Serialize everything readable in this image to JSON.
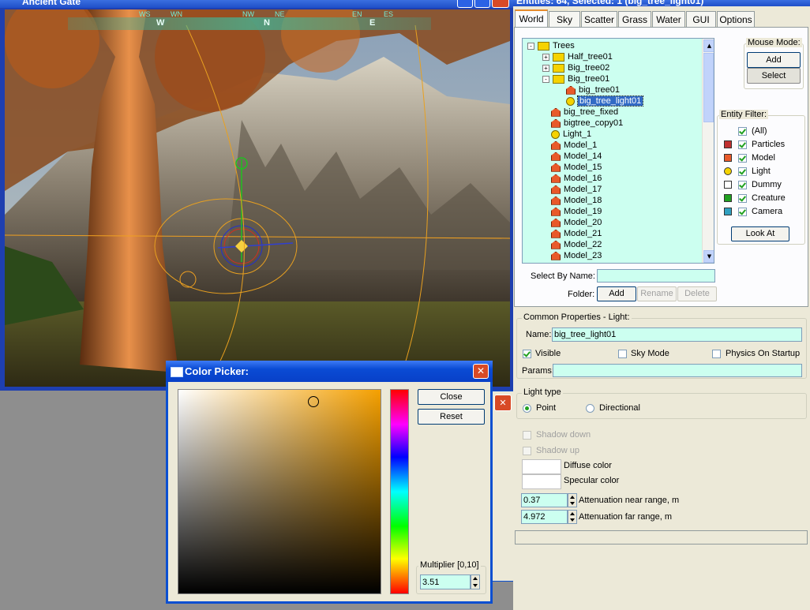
{
  "viewport": {
    "title": "Ancient Gate",
    "compass": [
      "WS",
      "WN",
      "W",
      "NW",
      "NE",
      "N",
      "EN",
      "ES",
      "E"
    ]
  },
  "editor": {
    "title": "Entities: 64, Selected: 1 (big_tree_light01)",
    "tabs": [
      "World",
      "Sky",
      "Scatter",
      "Grass",
      "Water",
      "GUI",
      "Options"
    ],
    "active_tab": "World",
    "tree": [
      {
        "label": "Trees",
        "icon": "folder-icon",
        "indent": 0,
        "expander": "-"
      },
      {
        "label": "Half_tree01",
        "icon": "folder-icon",
        "indent": 1,
        "expander": "+"
      },
      {
        "label": "Big_tree02",
        "icon": "folder-icon",
        "indent": 1,
        "expander": "+"
      },
      {
        "label": "Big_tree01",
        "icon": "folder-icon",
        "indent": 1,
        "expander": "-"
      },
      {
        "label": "big_tree01",
        "icon": "model-icon",
        "indent": 2,
        "expander": ""
      },
      {
        "label": "big_tree_light01",
        "icon": "light-icon",
        "indent": 2,
        "expander": "",
        "selected": true
      },
      {
        "label": "big_tree_fixed",
        "icon": "model-icon",
        "indent": 1,
        "expander": ""
      },
      {
        "label": "bigtree_copy01",
        "icon": "model-icon",
        "indent": 1,
        "expander": ""
      },
      {
        "label": "Light_1",
        "icon": "light-icon",
        "indent": 1,
        "expander": ""
      },
      {
        "label": "Model_1",
        "icon": "model-icon",
        "indent": 1,
        "expander": ""
      },
      {
        "label": "Model_14",
        "icon": "model-icon",
        "indent": 1,
        "expander": ""
      },
      {
        "label": "Model_15",
        "icon": "model-icon",
        "indent": 1,
        "expander": ""
      },
      {
        "label": "Model_16",
        "icon": "model-icon",
        "indent": 1,
        "expander": ""
      },
      {
        "label": "Model_17",
        "icon": "model-icon",
        "indent": 1,
        "expander": ""
      },
      {
        "label": "Model_18",
        "icon": "model-icon",
        "indent": 1,
        "expander": ""
      },
      {
        "label": "Model_19",
        "icon": "model-icon",
        "indent": 1,
        "expander": ""
      },
      {
        "label": "Model_20",
        "icon": "model-icon",
        "indent": 1,
        "expander": ""
      },
      {
        "label": "Model_21",
        "icon": "model-icon",
        "indent": 1,
        "expander": ""
      },
      {
        "label": "Model_22",
        "icon": "model-icon",
        "indent": 1,
        "expander": ""
      },
      {
        "label": "Model_23",
        "icon": "model-icon",
        "indent": 1,
        "expander": ""
      }
    ],
    "mouse_mode": {
      "title": "Mouse Mode:",
      "add": "Add",
      "select": "Select"
    },
    "entity_filter": {
      "title": "Entity Filter:",
      "items": [
        {
          "label": "(All)",
          "icon": ""
        },
        {
          "label": "Particles",
          "icon": "particles-icon"
        },
        {
          "label": "Model",
          "icon": "model-icon"
        },
        {
          "label": "Light",
          "icon": "light-icon"
        },
        {
          "label": "Dummy",
          "icon": "dummy-icon"
        },
        {
          "label": "Creature",
          "icon": "creature-icon"
        },
        {
          "label": "Camera",
          "icon": "camera-icon"
        }
      ],
      "look_at": "Look At"
    },
    "select_by_name_label": "Select By Name:",
    "select_by_name_value": "",
    "folder_label": "Folder:",
    "folder_buttons": {
      "add": "Add",
      "rename": "Rename",
      "delete": "Delete"
    },
    "common": {
      "title": "Common Properties - Light:",
      "name_label": "Name:",
      "name_value": "big_tree_light01",
      "visible": "Visible",
      "sky_mode": "Sky Mode",
      "physics": "Physics On Startup",
      "params_label": "Params:",
      "params_value": ""
    },
    "light_type": {
      "title": "Light type",
      "point": "Point",
      "directional": "Directional",
      "selected": "Point"
    },
    "shadow_down": "Shadow down",
    "shadow_up": "Shadow up",
    "diffuse": "Diffuse color",
    "specular": "Specular color",
    "att_near_value": "0.37",
    "att_near_label": "Attenuation near range, m",
    "att_far_value": "4.972",
    "att_far_label": "Attenuation far range, m"
  },
  "color_picker": {
    "title": "Color Picker:",
    "close": "Close",
    "reset": "Reset",
    "multiplier_label": "Multiplier [0,10]",
    "multiplier_value": "3.51",
    "base_color": "#f5a000"
  }
}
